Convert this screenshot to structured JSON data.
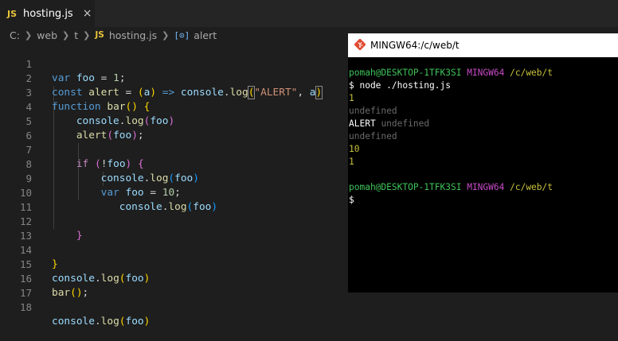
{
  "tab": {
    "icon_label": "JS",
    "filename": "hosting.js",
    "close_symbol": "×"
  },
  "breadcrumb": {
    "items": [
      "C:",
      "web",
      "t"
    ],
    "file_icon": "JS",
    "file": "hosting.js",
    "symbol_icon": "[⊙]",
    "symbol": "alert"
  },
  "editor": {
    "line_numbers": [
      "1",
      "2",
      "3",
      "4",
      "5",
      "6",
      "7",
      "8",
      "9",
      "10",
      "11",
      "12",
      "13",
      "14",
      "15",
      "16",
      "17",
      "18"
    ],
    "tokens": {
      "var": "var",
      "foo": "foo",
      "eq": " = ",
      "one": "1",
      "semi": ";",
      "const": "const",
      "alert": "alert",
      "a": "a",
      "arrow": "=>",
      "console": "console",
      "log": "log",
      "alert_str": "\"ALERT\"",
      "comma": ", ",
      "function": "function",
      "bar": "bar",
      "if": "if",
      "not": "!",
      "ten": "10"
    }
  },
  "terminal": {
    "title": "MINGW64:/c/web/t",
    "prompt_user": "pomah@DESKTOP-1TFK3SI",
    "prompt_env": "MINGW64",
    "prompt_path": "/c/web/t",
    "command": "$ node ./hosting.js",
    "output": [
      "1",
      "undefined",
      "ALERT",
      "undefined",
      "undefined",
      "10",
      "1"
    ],
    "cursor_prompt": "$"
  }
}
